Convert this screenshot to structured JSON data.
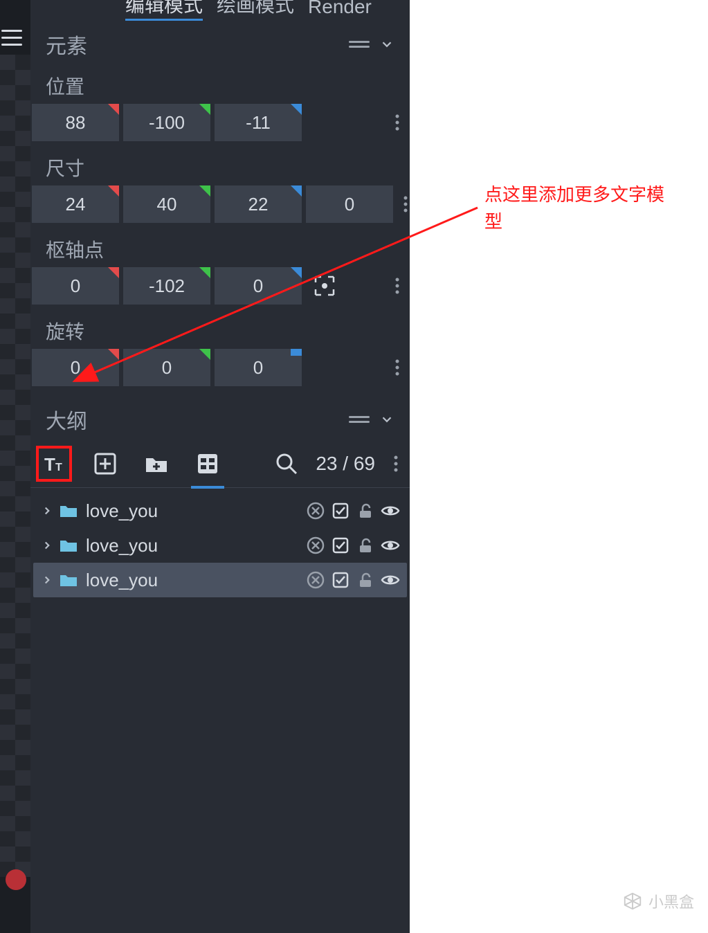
{
  "tabs": {
    "edit": "编辑模式",
    "paint": "绘画模式",
    "render": "Render"
  },
  "sections": {
    "elements": {
      "title": "元素"
    },
    "position": {
      "label": "位置",
      "x": "88",
      "y": "-100",
      "z": "-11"
    },
    "size": {
      "label": "尺寸",
      "x": "24",
      "y": "40",
      "z": "22",
      "w": "0"
    },
    "pivot": {
      "label": "枢轴点",
      "x": "0",
      "y": "-102",
      "z": "0"
    },
    "rotation": {
      "label": "旋转",
      "x": "0",
      "y": "0",
      "z": "0"
    },
    "outliner": {
      "title": "大纲",
      "count": "23 / 69",
      "items": [
        {
          "name": "love_you",
          "selected": false
        },
        {
          "name": "love_you",
          "selected": false
        },
        {
          "name": "love_you",
          "selected": true
        }
      ]
    }
  },
  "annotation": {
    "text": "点这里添加更多文字模型"
  },
  "watermark": "小黑盒"
}
